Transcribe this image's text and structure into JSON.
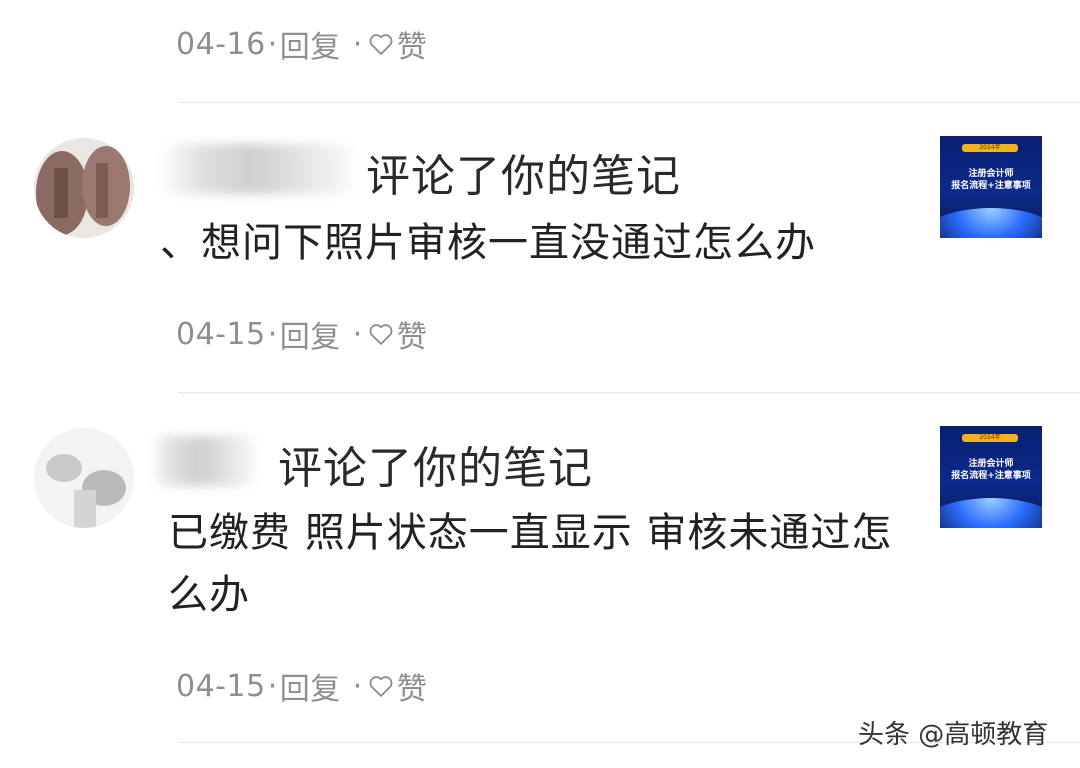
{
  "notifications": [
    {
      "date": "04-16",
      "reply_label": "回复",
      "like_label": "赞"
    },
    {
      "action": "评论了你的笔记",
      "comment": "、想问下照片审核一直没通过怎么办",
      "date": "04-15",
      "reply_label": "回复",
      "like_label": "赞",
      "thumb": {
        "badge": "2024年",
        "line1": "注册会计师",
        "line2": "报名流程+注意事项"
      }
    },
    {
      "action": "评论了你的笔记",
      "comment": "已缴费 照片状态一直显示 审核未通过怎么办",
      "date": "04-15",
      "reply_label": "回复",
      "like_label": "赞",
      "thumb": {
        "badge": "2024年",
        "line1": "注册会计师",
        "line2": "报名流程+注意事项"
      }
    }
  ],
  "watermark": "头条 @高顿教育",
  "colors": {
    "meta_text": "#8f8f8f",
    "divider": "#e8e8e8",
    "thumb_bg": "#0b2a8c",
    "thumb_badge": "#f1b21f"
  }
}
